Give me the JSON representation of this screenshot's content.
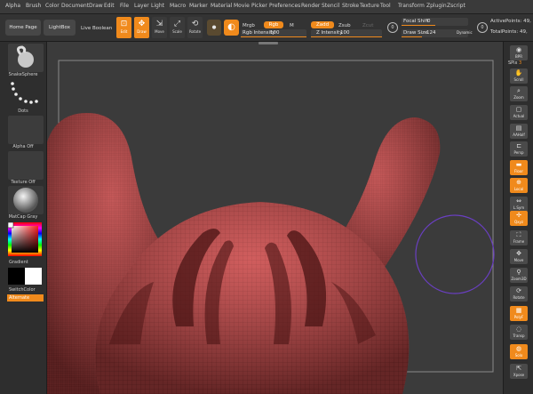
{
  "menu": [
    "Alpha",
    "Brush",
    "Color",
    "Document",
    "Draw",
    "Edit",
    "File",
    "Layer",
    "Light",
    "Macro",
    "Marker",
    "Material",
    "Movie",
    "Picker",
    "Preferences",
    "Render",
    "Stencil",
    "Stroke",
    "Texture",
    "Tool",
    "Transform",
    "Zplugin",
    "Zscript"
  ],
  "toolbar": {
    "home_page": "Home Page",
    "lightbox": "LightBox",
    "live_boolean": "Live Boolean",
    "tools": [
      {
        "label": "Edit",
        "icon": "edit-icon",
        "active": true
      },
      {
        "label": "Draw",
        "icon": "draw-icon",
        "active": true
      },
      {
        "label": "Move",
        "icon": "move-icon",
        "active": false
      },
      {
        "label": "Scale",
        "icon": "scale-icon",
        "active": false
      },
      {
        "label": "Rotate",
        "icon": "rotate-icon",
        "active": false
      }
    ],
    "mrgb": "Mrgb",
    "rgb": "Rgb",
    "m": "M",
    "rgb_intensity_label": "Rgb Intensity",
    "rgb_intensity_value": "100",
    "zadd": "Zadd",
    "zsub": "Zsub",
    "zcut": "Zcut",
    "z_intensity_label": "Z Intensity",
    "z_intensity_value": "100",
    "focal_shift_label": "Focal Shift",
    "focal_shift_value": "0",
    "draw_size_label": "Draw Size",
    "draw_size_value": "124",
    "dynamic": "Dynamic",
    "active_points_label": "ActivePoints:",
    "active_points_value": "49,",
    "total_points_label": "TotalPoints:",
    "total_points_value": "49,",
    "accent": "#f08a1c"
  },
  "left_panel": {
    "brush_name": "SnakeSphere",
    "stroke_name": "Dots",
    "alpha_name": "Alpha Off",
    "texture_name": "Texture Off",
    "material_name": "MatCap Gray",
    "gradient_label": "Gradient",
    "switch_color_label": "SwitchColor",
    "alternate_label": "Alternate"
  },
  "right_panel": {
    "spix_label": "SPix",
    "spix_value": "3",
    "buttons": [
      {
        "label": "BPR",
        "icon": "bpr-icon"
      },
      {
        "label": "Scroll",
        "icon": "scroll-icon"
      },
      {
        "label": "Zoom",
        "icon": "zoom-icon"
      },
      {
        "label": "Actual",
        "icon": "actual-icon"
      },
      {
        "label": "AAHalf",
        "icon": "aahalf-icon"
      },
      {
        "label": "Persp",
        "icon": "persp-icon"
      },
      {
        "label": "Floor",
        "icon": "floor-icon",
        "active": true
      },
      {
        "label": "Local",
        "icon": "local-icon",
        "active": true
      },
      {
        "label": "L.Sym",
        "icon": "lsym-icon"
      },
      {
        "label": "Qxyz",
        "icon": "xyz-icon",
        "active": true
      },
      {
        "label": "Frame",
        "icon": "frame-icon"
      },
      {
        "label": "Move",
        "icon": "move-icon"
      },
      {
        "label": "Zoom3D",
        "icon": "zoom3d-icon"
      },
      {
        "label": "Rotate",
        "icon": "rotate-icon"
      },
      {
        "label": "PolyF",
        "icon": "polyf-icon",
        "active": true
      },
      {
        "label": "Transp",
        "icon": "transp-icon"
      },
      {
        "label": "Solo",
        "icon": "solo-icon",
        "active": true
      },
      {
        "label": "Xpose",
        "icon": "xpose-icon"
      }
    ]
  },
  "canvas": {
    "mesh_color": "#c24a4a",
    "brush_cursor_color": "#6a3fc2"
  }
}
